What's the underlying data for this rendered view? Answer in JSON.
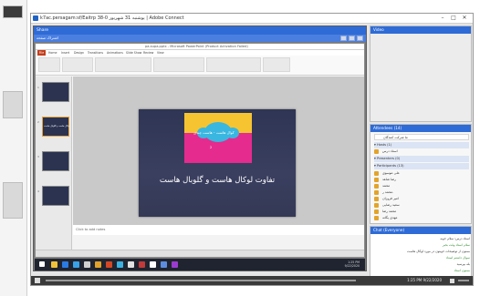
{
  "window": {
    "title": "k7ac.persagam:sf/Eaitrp 38-0 یوشنبه 31 شهریور | Adobe Connect",
    "controls": [
      "–",
      "□",
      "✕"
    ]
  },
  "share_pod": {
    "title": "Share",
    "subtitle": "اشتراک صفحه",
    "ppt_title": "pa-supa.pptx - Microsoft PowerPoint (Product Activation Failed)",
    "file_tab": "File",
    "tabs": [
      "Home",
      "Insert",
      "Design",
      "Transitions",
      "Animations",
      "Slide Show",
      "Review",
      "View"
    ],
    "slide_picture_text": "کوال هاست - هاست چندی",
    "slide_picture_subtext": "2",
    "slide_main_text": "تفاوت لوکال هاست و گلوبال هاست",
    "notes_placeholder": "Click to add notes",
    "thumb_numbers": [
      "1",
      "2",
      "3",
      "4"
    ],
    "thumb_text": "تفاوت لوکال هاست و گلوبال هاست",
    "taskbar_time": "1:25 PM",
    "taskbar_date": "9/22/2020"
  },
  "video_pod": {
    "title": "Video"
  },
  "attendees_pod": {
    "title": "Attendees (14)",
    "groups": [
      {
        "label": "▾ Hosts (1)",
        "items": [
          "استاد درس"
        ]
      },
      {
        "label": "▾ Presenters (0)",
        "items": []
      },
      {
        "label": "▾ Participants (13)",
        "items": [
          "علی موسوی",
          "رضا شاهد",
          "محمد",
          "محمد ر.",
          "امیر فروزان",
          "سعید رضایی",
          "محمد رضا",
          "مهدی یگانه",
          "امید فتحی"
        ]
      }
    ],
    "top_item": "ما شرکت کنندگان"
  },
  "chat_pod": {
    "title": "Chat (Everyone)",
    "lines": [
      {
        "text": "استاد درس: سلام خوبه",
        "green": false
      },
      {
        "text": "سلام استاد وقت بخیر",
        "green": true
      },
      {
        "text": "ممنون از توضیحات خوبتون در مورد لوکال هاست",
        "green": false
      },
      {
        "text": "سوال داشتم استاد",
        "green": true
      },
      {
        "text": "بله بپرسید",
        "green": false
      },
      {
        "text": "ممنون استاد",
        "green": true
      }
    ]
  },
  "bottom_bar": {
    "time": "1:25 PM 9/22/2020"
  },
  "colors": {
    "accent": "#2e6bd6",
    "slide_bg": "#2f3554",
    "slide_yellow": "#f6c431",
    "slide_pink": "#e52b8d",
    "slide_blue": "#39b7e0"
  }
}
